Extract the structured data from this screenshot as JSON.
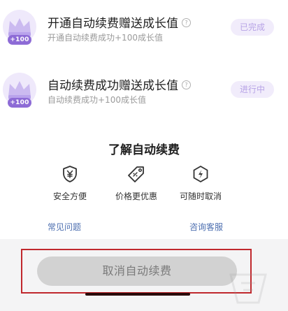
{
  "tasks": [
    {
      "badge_text": "+100",
      "title": "开通自动续费赠送成长值",
      "subtitle": "开通自动续费成功+100成长值",
      "status": "已完成"
    },
    {
      "badge_text": "+100",
      "title": "自动续费成功赠送成长值",
      "subtitle": "自动续费成功+100成长值",
      "status": "进行中"
    }
  ],
  "about": {
    "title": "了解自动续费",
    "features": [
      {
        "label": "安全方便",
        "icon": "shield-yen-icon"
      },
      {
        "label": "价格更优惠",
        "icon": "price-tag-icon"
      },
      {
        "label": "可随时取消",
        "icon": "lightning-hexagon-icon"
      }
    ],
    "links": {
      "faq": "常见问题",
      "customer_service": "咨询客服"
    }
  },
  "bottom": {
    "cancel_label": "取消自动续费"
  },
  "colors": {
    "accent_purple": "#8d6bd6",
    "pill_bg": "#f1ecfb",
    "pill_text": "#b7a3e6",
    "link_blue": "#4d6fb0",
    "highlight_red": "#c0282d",
    "button_grey": "#d2d2d2"
  }
}
